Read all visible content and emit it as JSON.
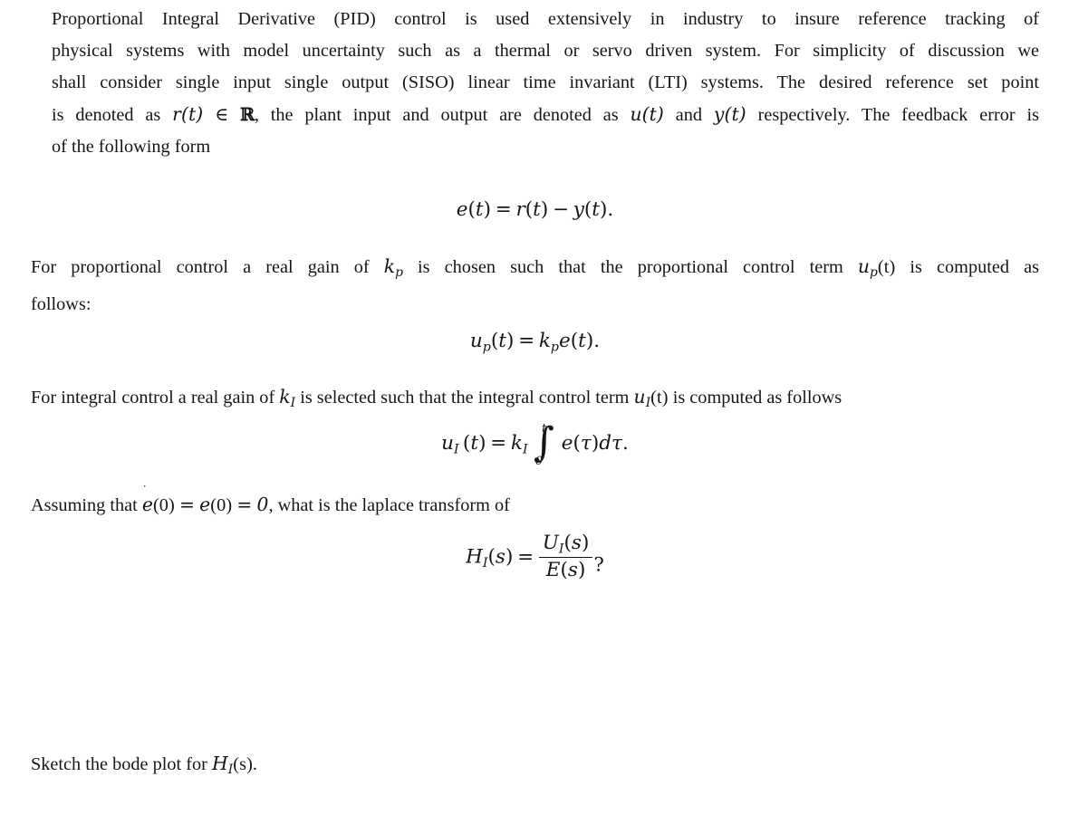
{
  "document": {
    "background_color": "#ffffff",
    "text_color": "#16161a",
    "paragraph1": {
      "line1": "Proportional Integral Derivative (PID) control is used extensively in industry to insure reference tracking of",
      "line2": "physical systems with model uncertainty such as a thermal or servo driven system. For simplicity of discussion we",
      "line3": "shall consider single input single output (SISO) linear time invariant (LTI) systems. The desired reference set point",
      "line4_a": "is denoted as",
      "line4_math1": "r(t)",
      "line4_b": "∈",
      "line4_math2": "ℝ",
      "line4_c": ", the plant input and output are denoted as",
      "line4_math3": "u(t)",
      "line4_d": "and",
      "line4_math4": "y(t)",
      "line4_e": "respectively. The feedback error is",
      "line5": "of the following form"
    },
    "equation1": {
      "lhs_var": "e",
      "lhs_arg": "(t)",
      "eq": "=",
      "term1_var": "r",
      "term1_arg": "(t)",
      "minus": "−",
      "term2_var": "y",
      "term2_arg": "(t)",
      "period": ".",
      "plain": "e(t) = r(t) − y(t)."
    },
    "paragraph2": {
      "line1_a": "For proportional control a real gain of",
      "line1_math_base": "k",
      "line1_math_sub": "p",
      "line1_b": "is chosen such that the proportional control term",
      "line1_math2_base": "u",
      "line1_math2_sub": "p",
      "line1_math2_arg": "(t)",
      "line1_c": "is computed as",
      "line2": "follows:"
    },
    "equation2": {
      "lhs_base": "u",
      "lhs_sub": "p",
      "lhs_arg": "(t)",
      "eq": "=",
      "rhs_base": "k",
      "rhs_sub": "p",
      "rhs_factor": "e",
      "rhs_arg": "(t)",
      "period": ".",
      "plain": "u_p(t) = k_p e(t)."
    },
    "paragraph3": {
      "line1_a": "For integral control a real gain of",
      "line1_math_base": "k",
      "line1_math_sub": "I",
      "line1_b": "is selected such that the integral control term",
      "line1_math2_base": "u",
      "line1_math2_sub": "I",
      "line1_math2_arg": "(t)",
      "line1_c": "is computed as follows"
    },
    "equation3": {
      "lhs_base": "u",
      "lhs_sub": "I",
      "lhs_arg": "(t)",
      "eq": "=",
      "gain_base": "k",
      "gain_sub": "I",
      "integral_symbol": "∫",
      "limit_lower": "0",
      "limit_upper": "t",
      "integrand_var": "e",
      "integrand_arg": "(τ)",
      "differential": "dτ",
      "period": ".",
      "plain": "u_I(t) = k_I ∫_0^t e(τ)dτ."
    },
    "paragraph4": {
      "line1_a": "Assuming that",
      "line1_math_dot": "̇",
      "line1_math_var": "e",
      "line1_math_arg": "(0)",
      "line1_eq1": "=",
      "line1_math_var2": "e",
      "line1_math_arg2": "(0)",
      "line1_eq2": "=",
      "line1_zero": "0",
      "line1_b": ", what is the laplace transform of"
    },
    "equation4": {
      "lhs_base": "H",
      "lhs_sub": "I",
      "lhs_arg": "(s)",
      "eq": "=",
      "numerator_base": "U",
      "numerator_sub": "I",
      "numerator_arg": "(s)",
      "denominator_base": "E",
      "denominator_arg": "(s)",
      "question_mark": "?",
      "plain": "H_I(s) = U_I(s)/E(s)?"
    },
    "paragraph5": {
      "line1_a": "Sketch the bode plot for",
      "line1_math_base": "H",
      "line1_math_sub": "I",
      "line1_math_arg": "(s)",
      "line1_b": "."
    }
  }
}
